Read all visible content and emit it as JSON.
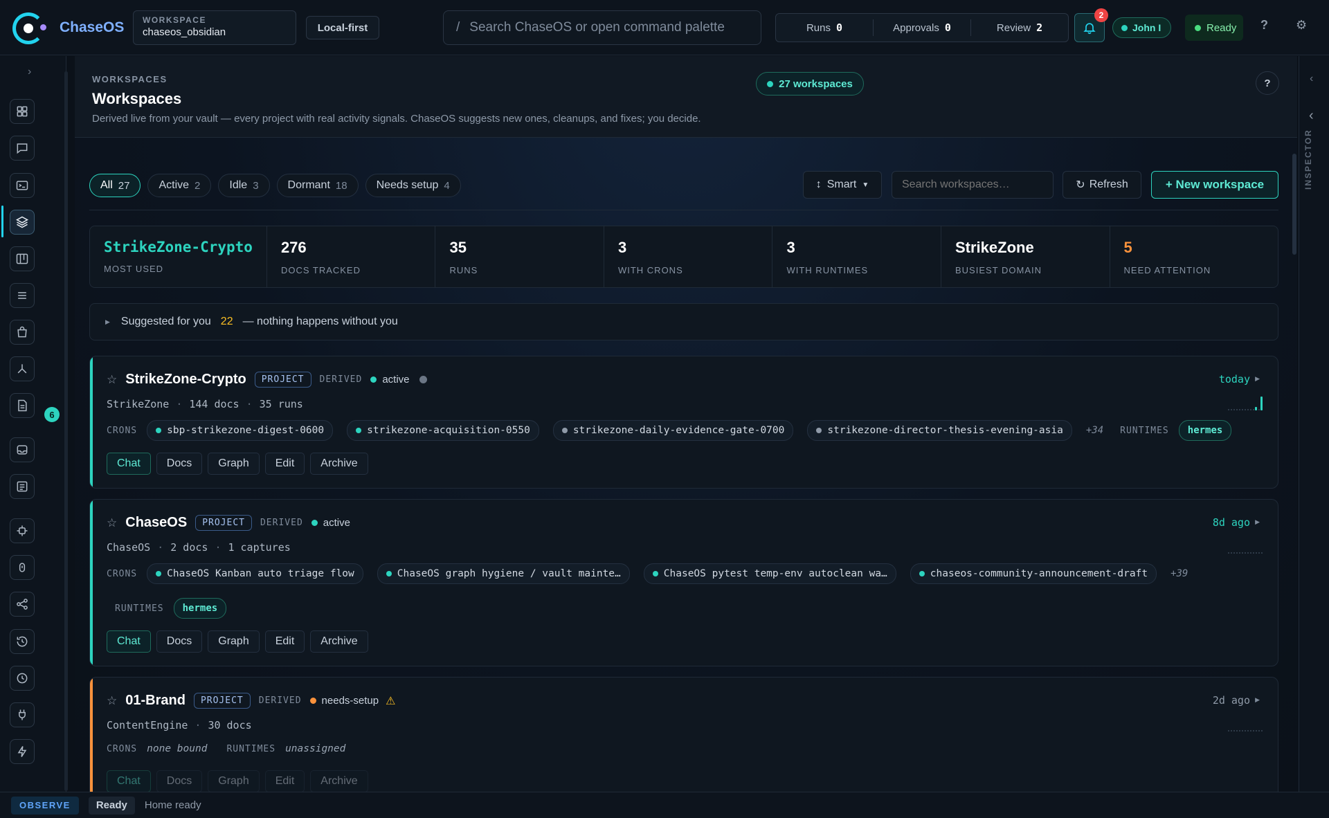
{
  "app": {
    "brand": "ChaseOS",
    "workspace_label": "WORKSPACE",
    "workspace_value": "chaseos_obsidian",
    "mode_button": "Local-first",
    "search_prefix": "/",
    "search_placeholder": "Search ChaseOS or open command palette",
    "counters": [
      {
        "label": "Runs",
        "value": "0"
      },
      {
        "label": "Approvals",
        "value": "0"
      },
      {
        "label": "Review",
        "value": "2"
      }
    ],
    "notifications": "2",
    "user": "John I",
    "status": "Ready",
    "colors": {
      "accent": "#2dd4bf",
      "brand": "#7fb0ff",
      "warn": "#fb923c"
    }
  },
  "sidebar": {
    "badge": "6",
    "icons": [
      "dashboard-icon",
      "chat-icon",
      "terminal-icon",
      "layers-icon",
      "kanban-icon",
      "list-icon",
      "bag-icon",
      "graph-icon",
      "document-icon",
      "inbox-icon",
      "notes-icon",
      "chip-icon",
      "database-icon",
      "share-icon",
      "history-icon",
      "clock-icon",
      "plug-icon",
      "bolt-icon"
    ]
  },
  "inspector": {
    "label": "INSPECTOR"
  },
  "page": {
    "eyebrow": "WORKSPACES",
    "title": "Workspaces",
    "subtitle": "Derived live from your vault — every project with real activity signals. ChaseOS suggests new ones, cleanups, and fixes; you decide.",
    "count_pill": "27 workspaces",
    "help": "?"
  },
  "filters": [
    {
      "label": "All",
      "count": "27",
      "active": true
    },
    {
      "label": "Active",
      "count": "2"
    },
    {
      "label": "Idle",
      "count": "3"
    },
    {
      "label": "Dormant",
      "count": "18"
    },
    {
      "label": "Needs setup",
      "count": "4"
    }
  ],
  "toolbar": {
    "sort_label": "Smart",
    "search_placeholder": "Search workspaces…",
    "refresh_label": "Refresh",
    "new_label": "+ New workspace"
  },
  "stats": [
    {
      "value": "StrikeZone-Crypto",
      "label": "MOST USED"
    },
    {
      "value": "276",
      "label": "DOCS TRACKED"
    },
    {
      "value": "35",
      "label": "RUNS"
    },
    {
      "value": "3",
      "label": "WITH CRONS"
    },
    {
      "value": "3",
      "label": "WITH RUNTIMES"
    },
    {
      "value": "StrikeZone",
      "label": "BUSIEST DOMAIN"
    },
    {
      "value": "5",
      "label": "NEED ATTENTION"
    }
  ],
  "suggest": {
    "label": "Suggested for you",
    "count": "22",
    "tail": "— nothing happens without you"
  },
  "labels": {
    "project": "PROJECT",
    "derived": "DERIVED",
    "crons": "CRONS",
    "runtimes": "RUNTIMES",
    "sep": "·"
  },
  "actions": [
    "Chat",
    "Docs",
    "Graph",
    "Edit",
    "Archive"
  ],
  "workspaces": [
    {
      "name": "StrikeZone-Crypto",
      "status": "active",
      "domain": "StrikeZone",
      "meta1": "144 docs",
      "meta2": "35 runs",
      "time": "today",
      "crons": [
        "sbp-strikezone-digest-0600",
        "strikezone-acquisition-0550",
        "strikezone-daily-evidence-gate-0700",
        "strikezone-director-thesis-evening-asia"
      ],
      "more": "+34",
      "runtime": "hermes"
    },
    {
      "name": "ChaseOS",
      "status": "active",
      "domain": "ChaseOS",
      "meta1": "2 docs",
      "meta2": "1 captures",
      "time": "8d ago",
      "crons": [
        "ChaseOS Kanban auto triage flow",
        "ChaseOS graph hygiene / vault mainte…",
        "ChaseOS pytest temp-env autoclean wa…",
        "chaseos-community-announcement-draft"
      ],
      "more": "+39",
      "runtime": "hermes"
    },
    {
      "name": "01-Brand",
      "status": "needs-setup",
      "domain": "ContentEngine",
      "meta1": "30 docs",
      "time": "2d ago",
      "crons_none": "none bound",
      "runtime_none": "unassigned"
    }
  ],
  "statusbar": {
    "mode": "OBSERVE",
    "state": "Ready",
    "message": "Home ready"
  }
}
